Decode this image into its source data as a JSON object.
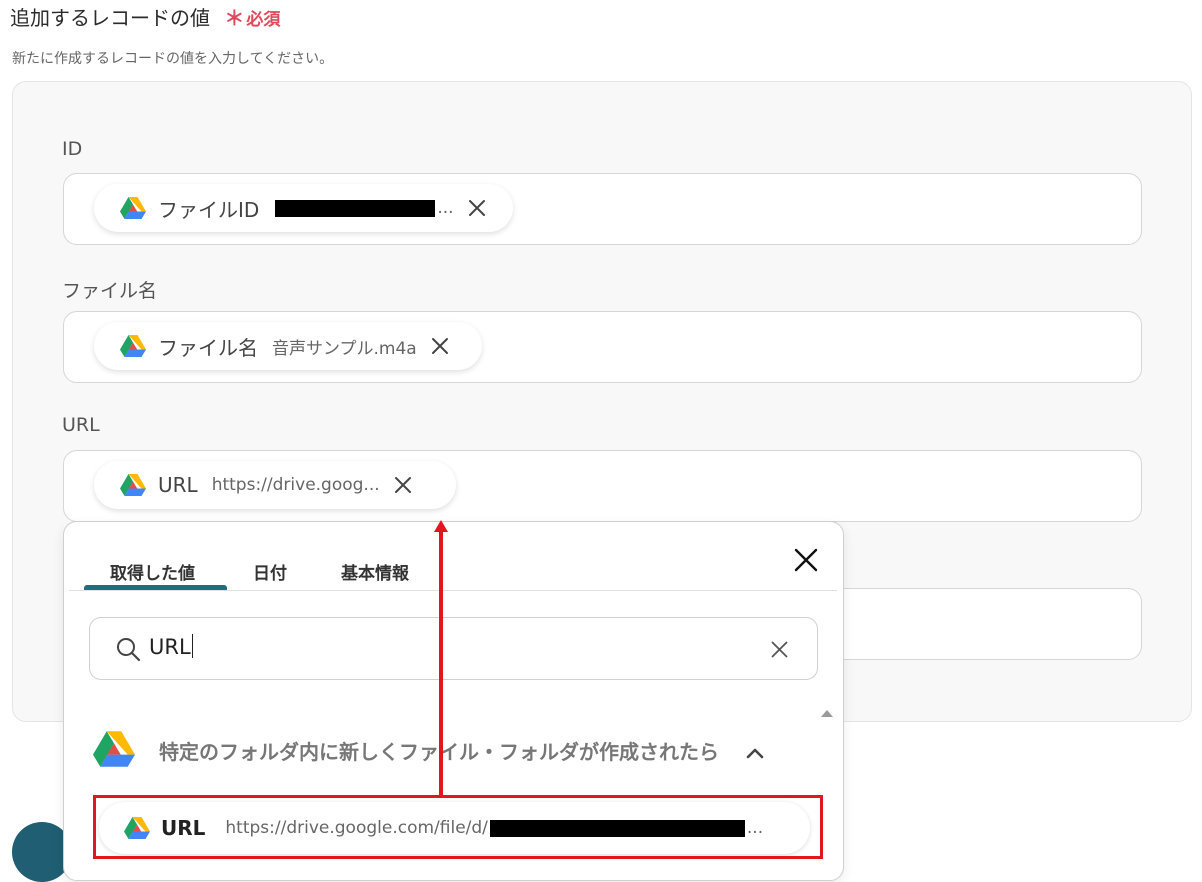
{
  "section": {
    "title": "追加するレコードの値",
    "required_mark": "＊",
    "required_label": "必須",
    "description": "新たに作成するレコードの値を入力してください。"
  },
  "fields": [
    {
      "label": "ID",
      "chip": {
        "icon": "google-drive-icon",
        "label": "ファイルID",
        "value_suffix": "..."
      }
    },
    {
      "label": "ファイル名",
      "chip": {
        "icon": "google-drive-icon",
        "label": "ファイル名",
        "value": "音声サンプル.m4a"
      }
    },
    {
      "label": "URL",
      "chip": {
        "icon": "google-drive-icon",
        "label": "URL",
        "value": "https://drive.goog..."
      }
    }
  ],
  "popup": {
    "tabs": [
      "取得した値",
      "日付",
      "基本情報"
    ],
    "active_tab": 0,
    "search": {
      "value": "URL"
    },
    "group": {
      "icon": "google-drive-icon",
      "title": "特定のフォルダ内に新しくファイル・フォルダが作成されたら"
    },
    "result": {
      "icon": "google-drive-icon",
      "label": "URL",
      "value_prefix": "https://drive.google.com/file/d/",
      "value_suffix": "..."
    }
  },
  "colors": {
    "accent": "#1f6d83",
    "required": "#e0485c",
    "annotation_red": "#e0171f"
  }
}
